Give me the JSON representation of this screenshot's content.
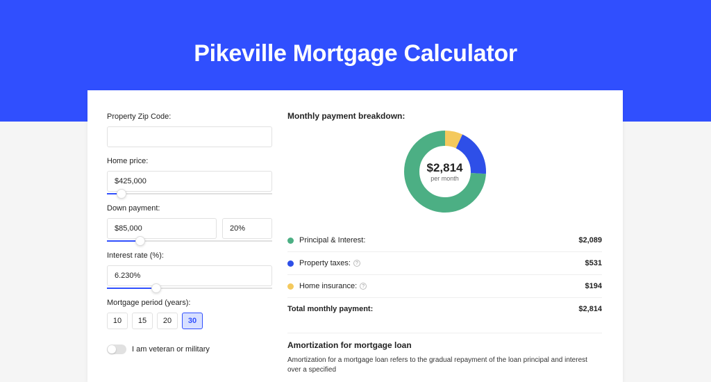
{
  "title": "Pikeville Mortgage Calculator",
  "form": {
    "zip_label": "Property Zip Code:",
    "zip_value": "",
    "home_price_label": "Home price:",
    "home_price_value": "$425,000",
    "home_price_slider_pct": 9,
    "down_payment_label": "Down payment:",
    "down_payment_value": "$85,000",
    "down_payment_pct_value": "20%",
    "down_payment_slider_pct": 20,
    "interest_label": "Interest rate (%):",
    "interest_value": "6.230%",
    "interest_slider_pct": 30,
    "period_label": "Mortgage period (years):",
    "periods": [
      "10",
      "15",
      "20",
      "30"
    ],
    "period_selected": "30",
    "veteran_label": "I am veteran or military"
  },
  "breakdown": {
    "title": "Monthly payment breakdown:",
    "donut_amount": "$2,814",
    "donut_sub": "per month",
    "items": [
      {
        "color": "green",
        "label": "Principal & Interest:",
        "value": "$2,089"
      },
      {
        "color": "blue",
        "label": "Property taxes:",
        "value": "$531",
        "help": true
      },
      {
        "color": "yellow",
        "label": "Home insurance:",
        "value": "$194",
        "help": true
      }
    ],
    "total_label": "Total monthly payment:",
    "total_value": "$2,814"
  },
  "amort": {
    "title": "Amortization for mortgage loan",
    "text": "Amortization for a mortgage loan refers to the gradual repayment of the loan principal and interest over a specified"
  },
  "chart_data": {
    "type": "pie",
    "title": "Monthly payment breakdown",
    "series": [
      {
        "name": "Principal & Interest",
        "value": 2089,
        "color": "#4CAF84"
      },
      {
        "name": "Property taxes",
        "value": 531,
        "color": "#2E4FE8"
      },
      {
        "name": "Home insurance",
        "value": 194,
        "color": "#F4C95D"
      }
    ],
    "total": 2814,
    "center_label": "$2,814 per month"
  }
}
